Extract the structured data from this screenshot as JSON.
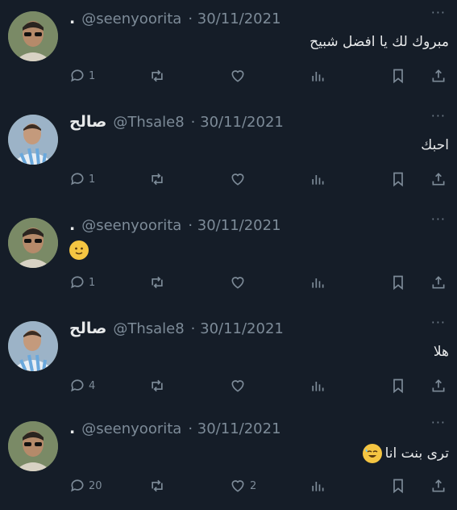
{
  "feed": {
    "tweets": [
      {
        "display_name": ".",
        "handle": "@seenyoorita",
        "date": "· 30/11/2021",
        "text": "مبروك لك يا افضل شبيح",
        "emoji": "",
        "reply_count": "1",
        "like_count": "",
        "avatar_icon": "man-sunglasses-avatar"
      },
      {
        "display_name": "صالح",
        "handle": "@Thsale8",
        "date": "· 30/11/2021",
        "text": "احبك",
        "emoji": "",
        "reply_count": "1",
        "like_count": "",
        "avatar_icon": "footballer-avatar"
      },
      {
        "display_name": ".",
        "handle": "@seenyoorita",
        "date": "· 30/11/2021",
        "text": "",
        "emoji": "slightly-smiling-face",
        "reply_count": "1",
        "like_count": "",
        "avatar_icon": "man-sunglasses-avatar"
      },
      {
        "display_name": "صالح",
        "handle": "@Thsale8",
        "date": "· 30/11/2021",
        "text": "هلا",
        "emoji": "",
        "reply_count": "4",
        "like_count": "",
        "avatar_icon": "footballer-avatar"
      },
      {
        "display_name": ".",
        "handle": "@seenyoorita",
        "date": "· 30/11/2021",
        "text": "ترى بنت انا",
        "emoji": "sweat-smile-face",
        "reply_count": "20",
        "like_count": "2",
        "avatar_icon": "man-sunglasses-avatar"
      }
    ],
    "more_label": "···"
  },
  "icons": [
    "reply-icon",
    "retweet-icon",
    "like-icon",
    "views-icon",
    "bookmark-icon",
    "share-icon",
    "more-icon"
  ],
  "colors": {
    "background": "#151d28",
    "text": "#e7e9ea",
    "muted": "#7d8b98"
  }
}
